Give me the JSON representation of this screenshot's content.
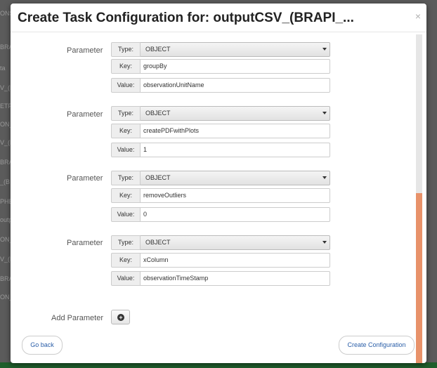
{
  "background": {
    "rows": [
      "ONS",
      "BRA",
      "ta",
      "V_(B",
      "ETF",
      "ON_",
      "V_(B",
      "BRA",
      "_(B",
      "PHE",
      "outp",
      "ON_",
      "V_(B",
      "BRA",
      "ON_"
    ]
  },
  "modal": {
    "title": "Create Task Configuration for: outputCSV_(BRAPI_...",
    "close_label": "×",
    "parameter_label": "Parameter",
    "type_label": "Type:",
    "key_label": "Key:",
    "value_label": "Value:",
    "parameters": [
      {
        "type": "OBJECT",
        "key": "groupBy",
        "value": "observationUnitName"
      },
      {
        "type": "OBJECT",
        "key": "createPDFwithPlots",
        "value": "1"
      },
      {
        "type": "OBJECT",
        "key": "removeOutliers",
        "value": "0"
      },
      {
        "type": "OBJECT",
        "key": "xColumn",
        "value": "observationTimeStamp"
      }
    ],
    "add_parameter_label": "Add Parameter",
    "go_back_label": "Go back",
    "create_config_label": "Create Configuration"
  },
  "colors": {
    "scroll_thumb": "#e8926a",
    "link_text": "#2a5ea8"
  }
}
